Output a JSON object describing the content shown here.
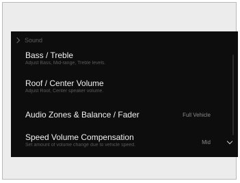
{
  "breadcrumb": {
    "label": "Sound"
  },
  "menu": {
    "items": [
      {
        "title": "Bass / Treble",
        "subtitle": "Adjust Bass, Mid-range, Treble levels."
      },
      {
        "title": "Roof / Center Volume",
        "subtitle": "Adjust Roof, Center speaker volume."
      },
      {
        "title": "Audio Zones & Balance / Fader",
        "value": "Full Vehicle"
      },
      {
        "title": "Speed Volume Compensation",
        "subtitle": "Set amount of volume change due to vehicle speed.",
        "value": "Mid"
      }
    ]
  },
  "icons": {
    "back": "chevron-right-icon",
    "more": "chevron-down-icon"
  },
  "colors": {
    "screen_bg": "#0d0d0d",
    "title_text": "#f2f2f2",
    "subtitle_text": "#5a5a5a"
  }
}
